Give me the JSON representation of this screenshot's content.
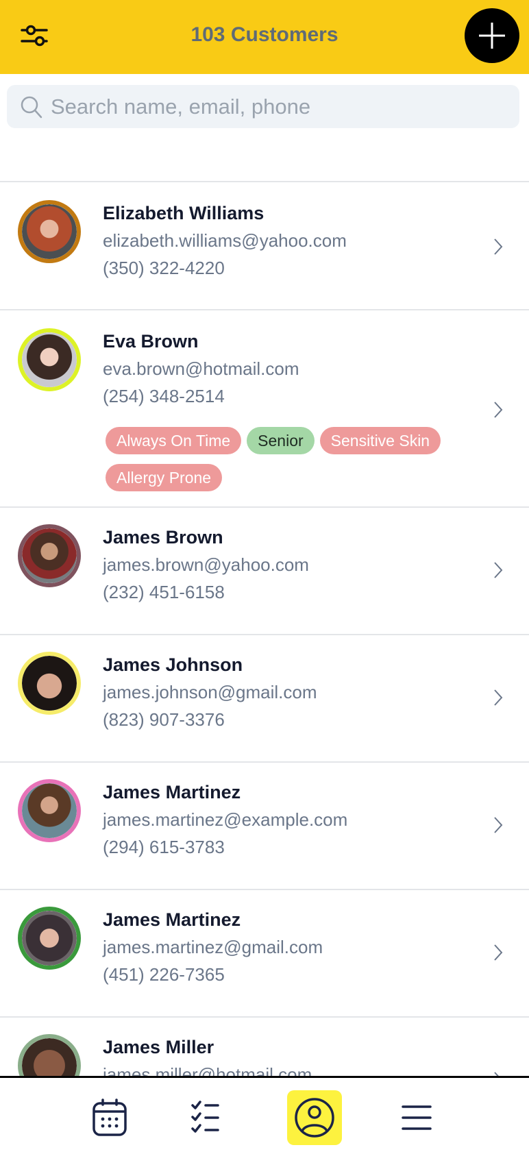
{
  "header": {
    "title": "103 Customers",
    "filter_icon": "sliders-icon",
    "add_icon": "plus-icon",
    "accent_color": "#F9CB15"
  },
  "search": {
    "placeholder": "Search name, email, phone",
    "value": "",
    "icon": "search-icon"
  },
  "customers": [
    {
      "name": "Elizabeth Williams",
      "email": "elizabeth.williams@yahoo.com",
      "phone": "(350) 322-4220",
      "ring_color": "#C27A12",
      "tags": []
    },
    {
      "name": "Eva Brown",
      "email": "eva.brown@hotmail.com",
      "phone": "(254) 348-2514",
      "ring_color": "#DDF227",
      "tags": [
        {
          "label": "Always On Time",
          "color": "red"
        },
        {
          "label": "Senior",
          "color": "green"
        },
        {
          "label": "Sensitive Skin",
          "color": "red"
        },
        {
          "label": "Allergy Prone",
          "color": "red"
        }
      ]
    },
    {
      "name": "James Brown",
      "email": "james.brown@yahoo.com",
      "phone": "(232) 451-6158",
      "ring_color": "#7F535E",
      "tags": []
    },
    {
      "name": "James Johnson",
      "email": "james.johnson@gmail.com",
      "phone": "(823) 907-3376",
      "ring_color": "#F6EC6A",
      "tags": []
    },
    {
      "name": "James Martinez",
      "email": "james.martinez@example.com",
      "phone": "(294) 615-3783",
      "ring_color": "#E872B8",
      "tags": []
    },
    {
      "name": "James Martinez",
      "email": "james.martinez@gmail.com",
      "phone": "(451) 226-7365",
      "ring_color": "#3A9A3C",
      "tags": []
    },
    {
      "name": "James Miller",
      "email": "james.miller@hotmail.com",
      "phone": "",
      "ring_color": "#8AAE8A",
      "tags": []
    }
  ],
  "bottom_nav": {
    "items": [
      {
        "name": "calendar",
        "icon": "calendar-icon",
        "active": false
      },
      {
        "name": "tasks",
        "icon": "checklist-icon",
        "active": false
      },
      {
        "name": "customers",
        "icon": "user-circle-icon",
        "active": true
      },
      {
        "name": "menu",
        "icon": "hamburger-menu-icon",
        "active": false
      }
    ],
    "active_color": "#FDF23F"
  }
}
